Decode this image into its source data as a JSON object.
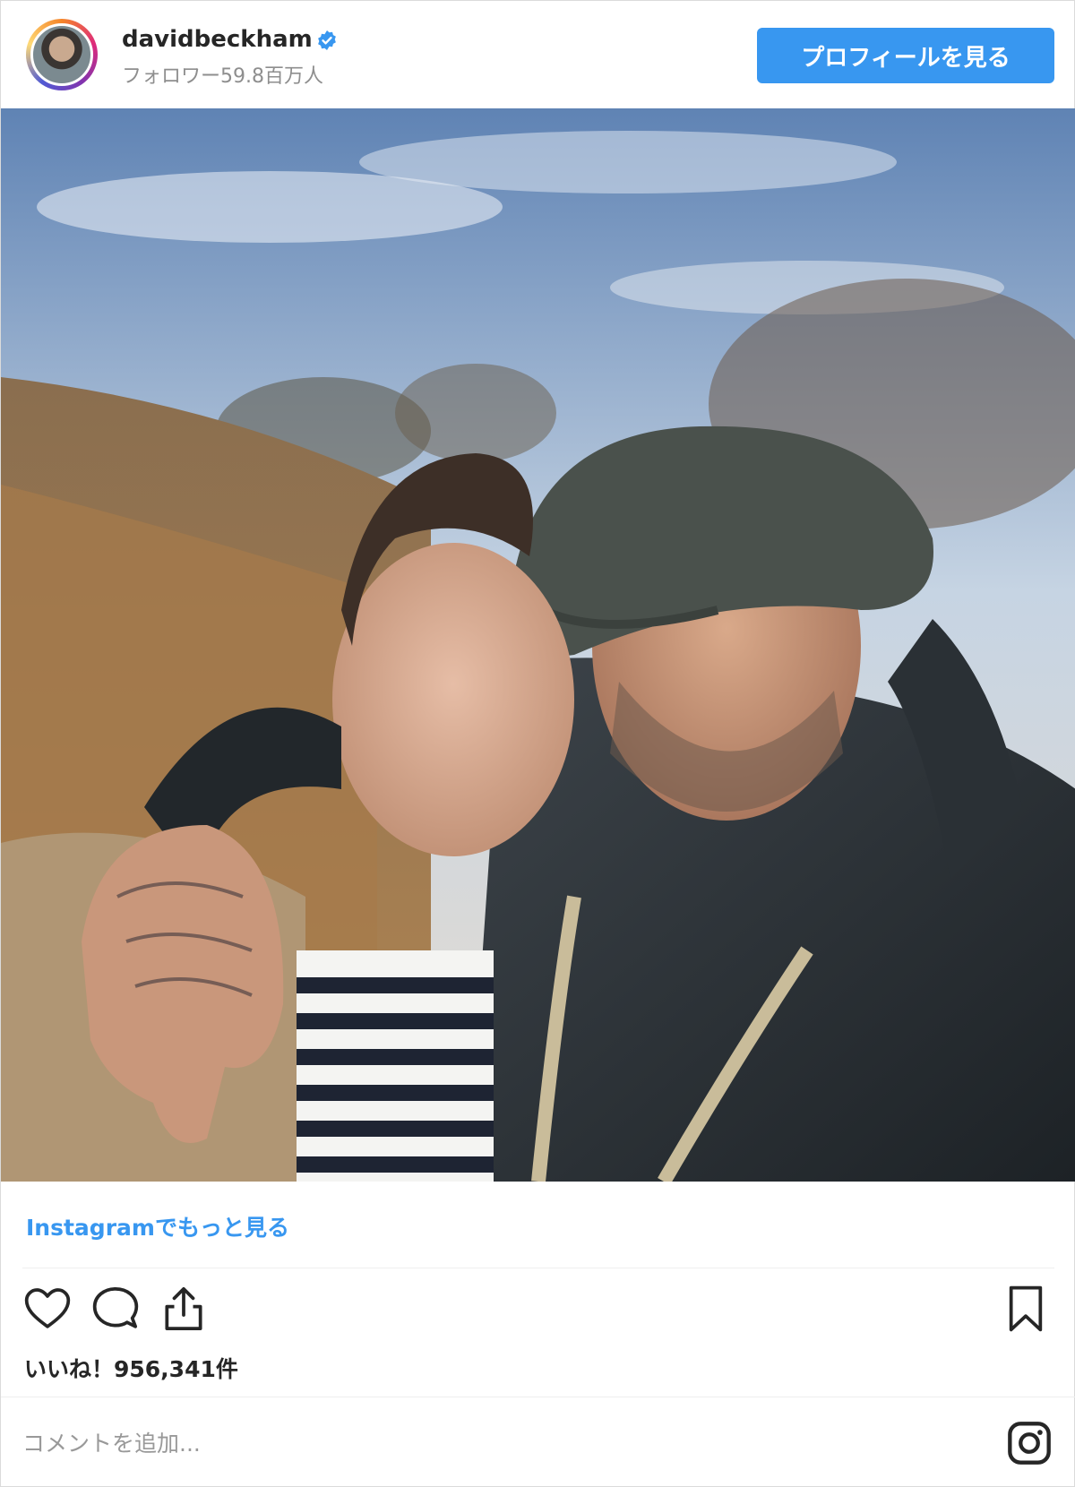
{
  "post": {
    "username": "davidbeckham",
    "followers": "フォロワー59.8百万人",
    "profile_button": "プロフィールを見る",
    "more_link": "Instagramでもっと見る",
    "likes": "いいね！956,341件",
    "comment_placeholder": "コメントを追加..."
  },
  "icons": {
    "verified": "verified-badge-icon",
    "like": "heart-icon",
    "comment": "comment-icon",
    "share": "share-icon",
    "save": "bookmark-icon",
    "instagram": "instagram-logo-icon"
  },
  "colors": {
    "accent": "#3897f0",
    "text": "#262626",
    "muted": "#8e8e8e"
  }
}
